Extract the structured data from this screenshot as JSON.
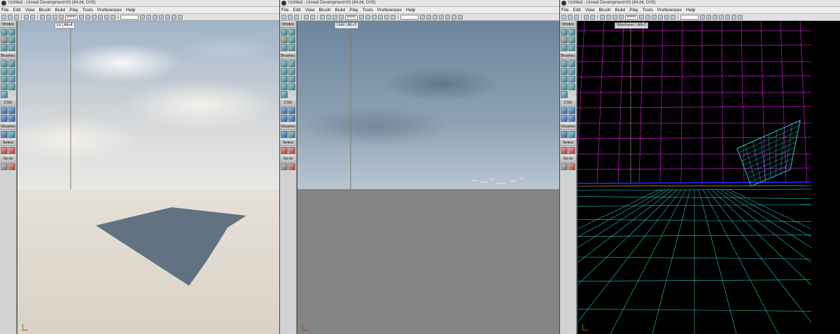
{
  "window": {
    "title": "Untitled - Unreal Development Kit (64-bit, DX9)",
    "menu": [
      "File",
      "Edit",
      "View",
      "Brush",
      "Build",
      "Play",
      "Tools",
      "Preferences",
      "Help"
    ],
    "toolbar_combo": "World"
  },
  "modes_panel": {
    "sections": [
      "Modes",
      "Brushes",
      "CSG",
      "Volumes",
      "Select",
      "Go to"
    ]
  },
  "viewports": [
    {
      "label": "Lit | Alt+4"
    },
    {
      "label": "Unlit | Alt+3"
    },
    {
      "label": "Wireframe | Alt+2"
    }
  ],
  "colors": {
    "wire_grid": "#c21cc8",
    "wire_mesh": "#22c9c4",
    "wire_horizon": "#2b2bff",
    "shadow": "#53667a"
  },
  "icons": {
    "camera_mode": "camera-icon",
    "geometry_mode": "geometry-icon",
    "paint_mode": "paintbrush-icon",
    "cube_brush": "cube-icon",
    "sphere_brush": "sphere-icon",
    "cylinder_brush": "cylinder-icon",
    "csg_add": "csg-add-icon",
    "volume": "volume-icon",
    "select_all": "select-icon",
    "goto_builder": "goto-icon"
  }
}
